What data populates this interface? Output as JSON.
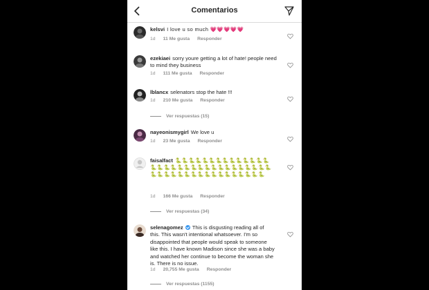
{
  "header": {
    "title": "Comentarios",
    "back_icon": "chevron-left-icon",
    "send_icon": "paper-plane-icon"
  },
  "colors": {
    "username": "#262626",
    "meta": "#8e8e8e",
    "verified": "#3897f0",
    "background": "#000000"
  },
  "comments": [
    {
      "username": "kelsvi",
      "text": "I love u so much 💗💗💗💗💗",
      "time": "1d",
      "likes": "11 Me gusta",
      "reply": "Responder"
    },
    {
      "username": "ezekiaei",
      "text": "sorry youre getting a lot of hate! people need to mind they business",
      "time": "1d",
      "likes": "111 Me gusta",
      "reply": "Responder"
    },
    {
      "username": "lblancx",
      "text": "selenators stop the hate !!!",
      "time": "1d",
      "likes": "210 Me gusta",
      "reply": "Responder",
      "view_replies": "Ver respuestas (15)"
    },
    {
      "username": "nayeonismygirl",
      "text": "We love u",
      "time": "1d",
      "likes": "23 Me gusta",
      "reply": "Responder"
    },
    {
      "username": "faisalfact",
      "text": "🐍🐍🐍🐍🐍🐍🐍🐍🐍🐍🐍🐍🐍🐍🐍🐍🐍🐍🐍🐍🐍🐍🐍🐍🐍🐍🐍🐍🐍🐍🐍🐍🐍🐍🐍🐍🐍🐍🐍🐍🐍🐍🐍🐍🐍🐍🐍🐍🐍",
      "time": "1d",
      "likes": "166 Me gusta",
      "reply": "Responder",
      "view_replies": "Ver respuestas (34)"
    },
    {
      "username": "selenagomez",
      "verified": true,
      "text": "This is disgusting reading all of this. This wasn't intentional whatsoever. I'm so disappointed that people would speak to someone like this. I have known Madison since she was a baby and watched her continue to become the woman she is. There is no issue.",
      "time": "1d",
      "likes": "20,755 Me gusta",
      "reply": "Responder",
      "view_replies": "Ver respuestas (1155)"
    }
  ]
}
